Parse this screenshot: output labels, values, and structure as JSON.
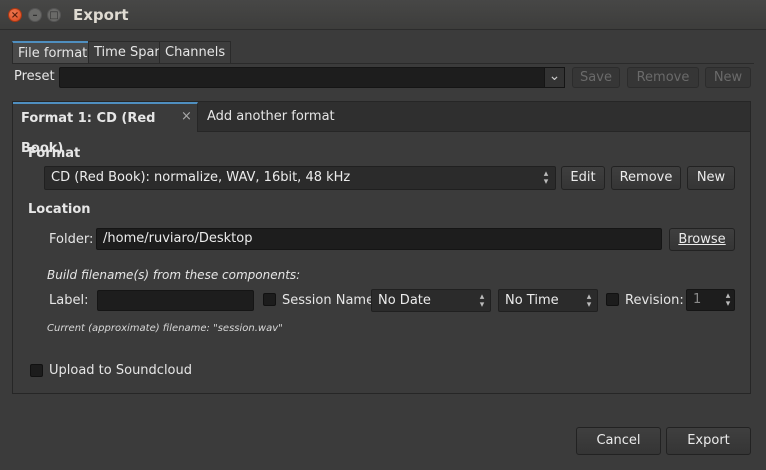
{
  "window": {
    "title": "Export",
    "close_glyph": "×",
    "min_glyph": "–",
    "max_glyph": "□"
  },
  "tabs": [
    "File format",
    "Time Span",
    "Channels"
  ],
  "preset": {
    "label": "Preset",
    "value": "",
    "save": "Save",
    "remove": "Remove",
    "new": "New"
  },
  "inner_tabs": {
    "format_tab": "Format 1: CD (Red Book)",
    "close_glyph": "×",
    "add_tab": "Add another format"
  },
  "format": {
    "heading": "Format",
    "selected": "CD (Red Book): normalize, WAV, 16bit, 48 kHz",
    "edit": "Edit",
    "remove": "Remove",
    "new": "New"
  },
  "location": {
    "heading": "Location",
    "folder_label": "Folder:",
    "folder_value": "/home/ruviaro/Desktop",
    "browse": "Browse"
  },
  "filename": {
    "heading": "Build filename(s) from these components:",
    "label_label": "Label:",
    "label_value": "",
    "session_name": "Session Name",
    "date": "No Date",
    "time": "No Time",
    "revision_label": "Revision:",
    "revision_value": "1",
    "current": "Current (approximate) filename: \"session.wav\""
  },
  "upload": {
    "label": "Upload to Soundcloud"
  },
  "footer": {
    "cancel": "Cancel",
    "export": "Export"
  },
  "icons": {
    "combo_arrow": "⌄",
    "spin_up": "▴",
    "spin_down": "▾"
  }
}
